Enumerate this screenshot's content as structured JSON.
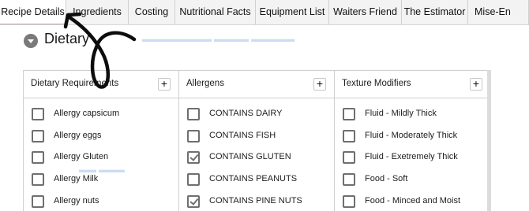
{
  "tabs": [
    {
      "label": "Recipe Details",
      "active": true
    },
    {
      "label": "Ingredients",
      "active": false
    },
    {
      "label": "Costing",
      "active": false
    },
    {
      "label": "Nutritional Facts",
      "active": false
    },
    {
      "label": "Equipment List",
      "active": false
    },
    {
      "label": "Waiters Friend",
      "active": false
    },
    {
      "label": "The Estimator",
      "active": false
    },
    {
      "label": "Mise-En",
      "active": false
    }
  ],
  "section": {
    "title": "Dietary"
  },
  "columns": [
    {
      "title": "Dietary Requirements",
      "add_label": "+",
      "items": [
        {
          "label": "Allergy capsicum",
          "checked": false
        },
        {
          "label": "Allergy eggs",
          "checked": false
        },
        {
          "label": "Allergy Gluten",
          "checked": false
        },
        {
          "label": "Allergy Milk",
          "checked": false
        },
        {
          "label": "Allergy nuts",
          "checked": false
        }
      ]
    },
    {
      "title": "Allergens",
      "add_label": "+",
      "items": [
        {
          "label": "CONTAINS DAIRY",
          "checked": false
        },
        {
          "label": "CONTAINS FISH",
          "checked": false
        },
        {
          "label": "CONTAINS GLUTEN",
          "checked": true
        },
        {
          "label": "CONTAINS PEANUTS",
          "checked": false
        },
        {
          "label": "CONTAINS PINE NUTS",
          "checked": true
        }
      ]
    },
    {
      "title": "Texture Modifiers",
      "add_label": "+",
      "items": [
        {
          "label": "Fluid - Mildly Thick",
          "checked": false
        },
        {
          "label": "Fluid - Moderately Thick",
          "checked": false
        },
        {
          "label": "Fluid - Exetremely Thick",
          "checked": false
        },
        {
          "label": "Food - Soft",
          "checked": false
        },
        {
          "label": "Food - Minced and Moist",
          "checked": false
        }
      ]
    }
  ],
  "colors": {
    "active_tab_underline": "#c9a0a6",
    "checkbox": "#6f6f6f",
    "annotation": "#0d0d0d"
  }
}
